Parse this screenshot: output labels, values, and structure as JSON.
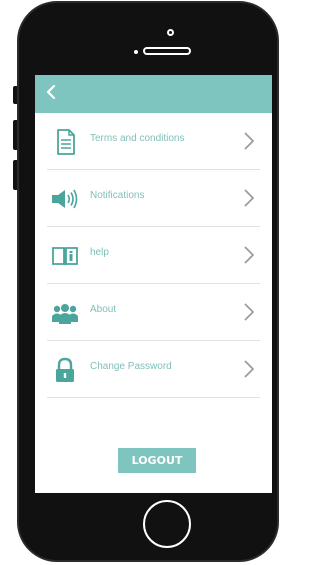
{
  "colors": {
    "accent": "#7fc5bf",
    "label": "#7fbfba",
    "chevron": "#9c9c9c",
    "divider": "#e2e2e2"
  },
  "header": {
    "back_icon": "chevron-left-icon"
  },
  "menu": {
    "items": [
      {
        "label": "Terms and conditions",
        "icon": "document-icon"
      },
      {
        "label": "Notifications",
        "icon": "speaker-icon"
      },
      {
        "label": "help",
        "icon": "book-icon"
      },
      {
        "label": "About",
        "icon": "people-icon"
      },
      {
        "label": "Change Password",
        "icon": "lock-icon"
      }
    ]
  },
  "footer": {
    "logout_label": "LOGOUT"
  }
}
